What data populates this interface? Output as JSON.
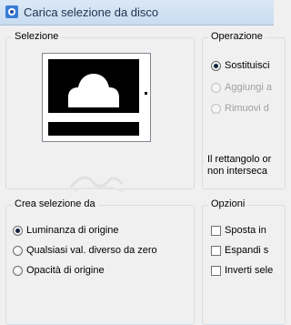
{
  "window": {
    "title": "Carica selezione da disco",
    "icon": "app-icon"
  },
  "selezione": {
    "label": "Selezione",
    "preview_icon": "selection-mask-preview",
    "watermark": "decorative-watermark"
  },
  "operazione": {
    "label": "Operazione",
    "options": [
      {
        "label": "Sostituisci",
        "checked": true,
        "disabled": false
      },
      {
        "label": "Aggiungi a",
        "checked": false,
        "disabled": true
      },
      {
        "label": "Rimuovi d",
        "checked": false,
        "disabled": true
      }
    ],
    "note_line1": "Il rettangolo or",
    "note_line2": "non interseca"
  },
  "crea_selezione": {
    "label": "Crea selezione da",
    "options": [
      {
        "label": "Luminanza di origine",
        "checked": true
      },
      {
        "label": "Qualsiasi val. diverso da zero",
        "checked": false
      },
      {
        "label": "Opacità di origine",
        "checked": false
      }
    ]
  },
  "opzioni": {
    "label": "Opzioni",
    "checkboxes": [
      {
        "label": "Sposta in",
        "checked": false
      },
      {
        "label": "Espandi s",
        "checked": false
      },
      {
        "label": "Inverti sele",
        "checked": false
      }
    ]
  },
  "colors": {
    "title_text": "#1e3050",
    "group_border": "#d5dfe5",
    "background": "#f0f0f0"
  }
}
